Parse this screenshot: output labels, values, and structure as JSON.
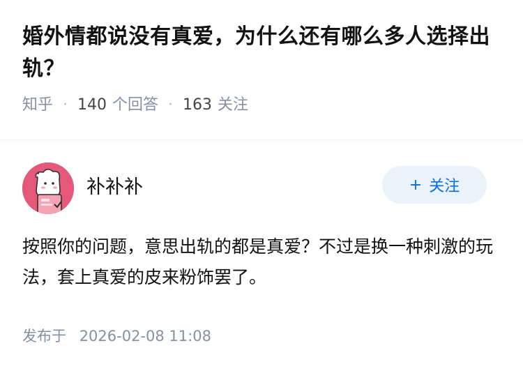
{
  "question": {
    "title": "婚外情都说没有真爱，为什么还有哪么多人选择出轨？",
    "source": "知乎",
    "answer_count": "140",
    "answer_label": "个回答",
    "follower_count": "163",
    "follower_label": "关注"
  },
  "answer": {
    "author_name": "补补补",
    "follow_button": {
      "icon": "plus-icon",
      "label": "关注"
    },
    "content": "按照你的问题，意思出轨的都是真爱？不过是换一种刺激的玩法，套上真爱的皮来粉饰罢了。",
    "publish_label": "发布于",
    "publish_time": "2026-02-08 11:08"
  },
  "colors": {
    "accent": "#056de8",
    "accent_bg": "#eaf2fb",
    "meta_text": "#8590a6",
    "avatar_bg": "#e4587a"
  }
}
